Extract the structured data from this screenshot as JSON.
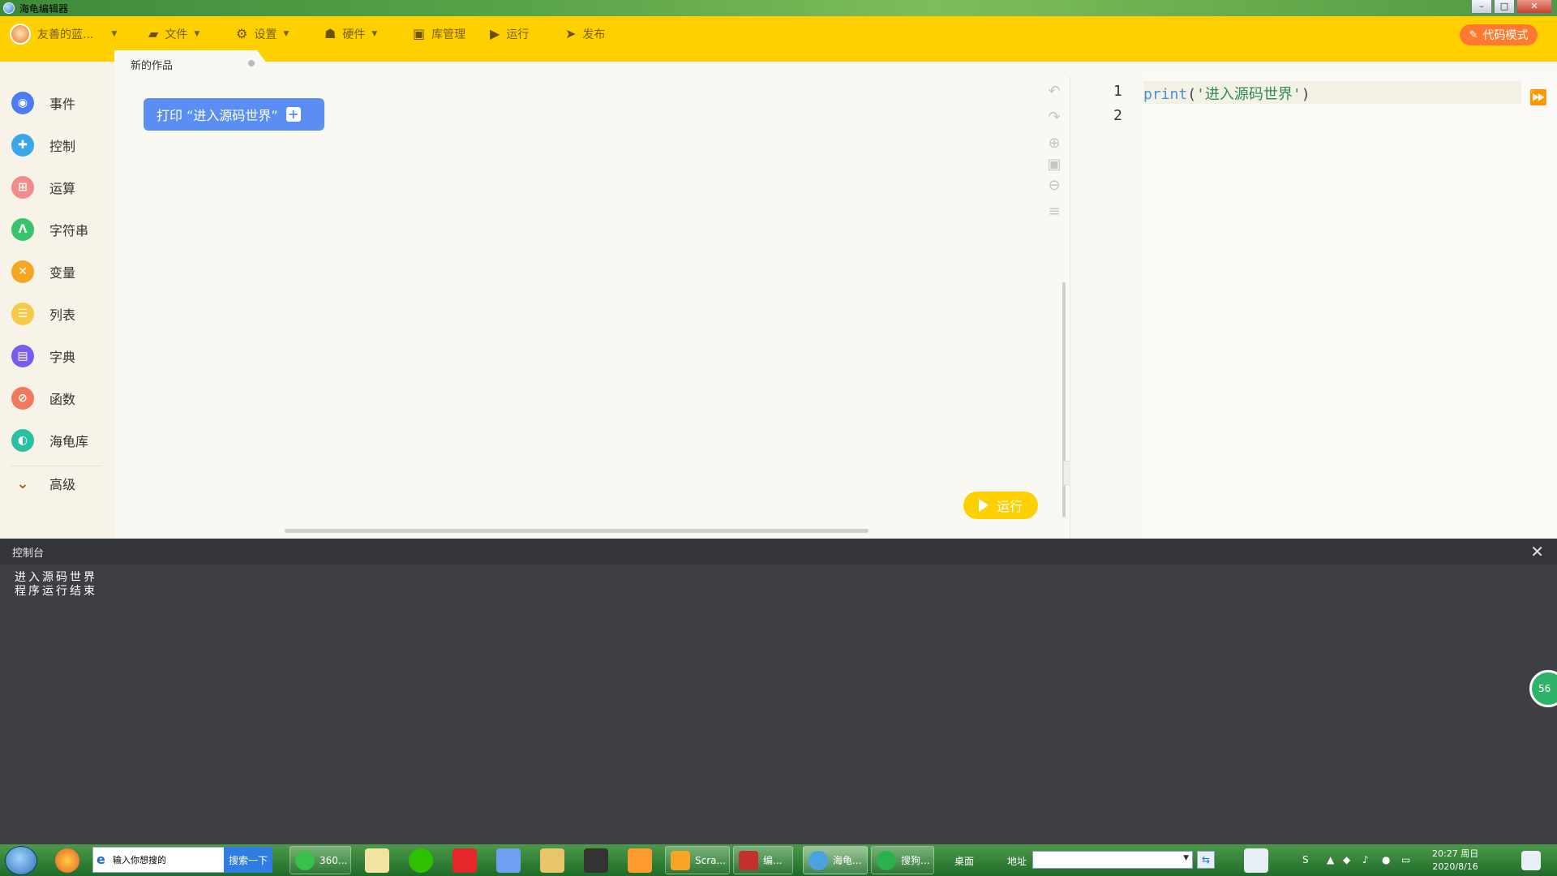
{
  "window": {
    "title": "海龟编辑器",
    "controls": [
      "–",
      "□",
      "✕"
    ]
  },
  "toolbar": {
    "user_name": "友善的蓝...",
    "file": "文件",
    "settings": "设置",
    "hardware": "硬件",
    "library": "库管理",
    "run": "运行",
    "publish": "发布",
    "code_mode": "代码模式"
  },
  "tab": {
    "name": "新的作品"
  },
  "categories": [
    {
      "label": "事件",
      "color": "#4c7cf0",
      "icon": "toggle-icon"
    },
    {
      "label": "控制",
      "color": "#3aa8e8",
      "icon": "gamepad-icon"
    },
    {
      "label": "运算",
      "color": "#f28b8b",
      "icon": "calculator-icon"
    },
    {
      "label": "字符串",
      "color": "#37c46a",
      "icon": "letter-a-icon"
    },
    {
      "label": "变量",
      "color": "#f5a623",
      "icon": "x-icon"
    },
    {
      "label": "列表",
      "color": "#f7c948",
      "icon": "list-icon"
    },
    {
      "label": "字典",
      "color": "#7b5cf0",
      "icon": "book-icon"
    },
    {
      "label": "函数",
      "color": "#f07a5a",
      "icon": "function-icon"
    },
    {
      "label": "海龟库",
      "color": "#2bbfa4",
      "icon": "turtle-icon"
    },
    {
      "label": "高级",
      "color": "#ffffff",
      "icon": "chevron-down-icon"
    }
  ],
  "workspace": {
    "block_text": "打印 “进入源码世界”",
    "run_label": "运行"
  },
  "editor": {
    "line_numbers": [
      "1",
      "2"
    ],
    "code": {
      "fn": "print",
      "open": "(",
      "str": "'进入源码世界'",
      "close": ")"
    }
  },
  "console": {
    "title": "控制台",
    "lines": [
      "进入源码世界",
      "程序运行结束"
    ]
  },
  "float_badge": "56",
  "taskbar": {
    "search_placeholder": "输入你想搜的",
    "search_button": "搜索一下",
    "tasks": [
      "360...",
      "Scra...",
      "编...",
      "海龟...",
      "搜狗..."
    ],
    "desktop_label": "桌面",
    "address_label": "地址",
    "time": "20:27 周日",
    "date": "2020/8/16"
  },
  "colors": {
    "toolbar": "#ffd000",
    "code_mode": "#ff7a2e",
    "block": "#5b8ef2",
    "console": "#3d3f45"
  }
}
